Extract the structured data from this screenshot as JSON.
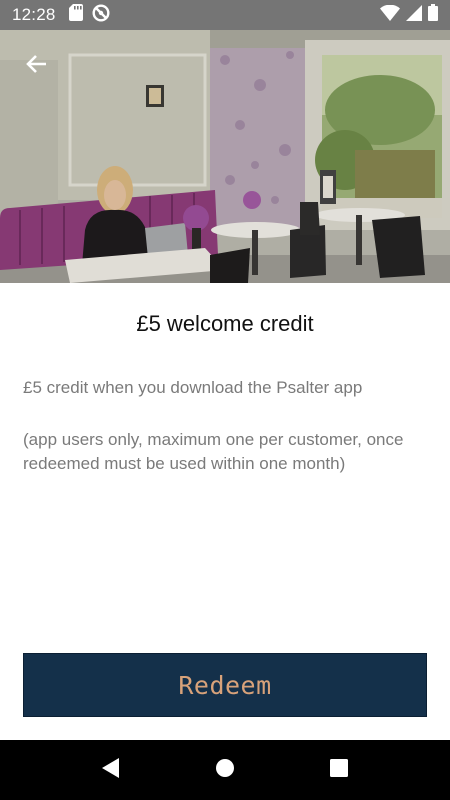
{
  "status_bar": {
    "time": "12:28",
    "left_icons": [
      "sd-card-icon",
      "no-disturb-icon"
    ],
    "right_icons": [
      "wifi-icon",
      "cell-signal-icon",
      "battery-icon"
    ]
  },
  "hero": {
    "back_icon": "arrow-back-icon"
  },
  "offer": {
    "title": "£5 welcome credit",
    "description": "£5 credit when you download the Psalter app",
    "terms": "(app users only, maximum one per customer, once redeemed must be used within one month)"
  },
  "actions": {
    "redeem_label": "Redeem"
  },
  "colors": {
    "status_bar": "#757575",
    "button_bg": "#14304a",
    "button_text": "#d8a27a",
    "body_text": "#7a7a7a",
    "title_text": "#111111",
    "nav_bar": "#000000"
  },
  "nav_bar": {
    "icons": [
      "nav-back-icon",
      "nav-home-icon",
      "nav-recents-icon"
    ]
  }
}
